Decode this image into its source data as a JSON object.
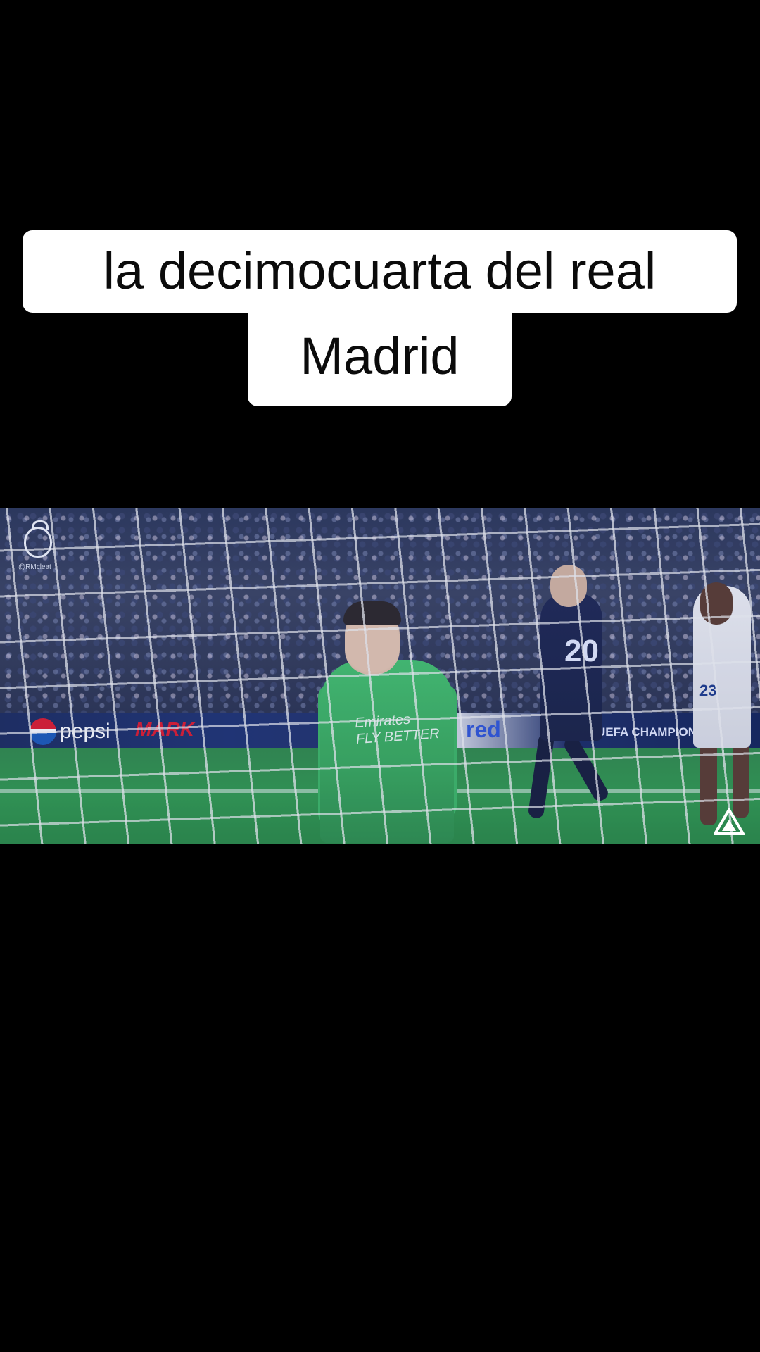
{
  "caption": {
    "line1": "la decimocuarta del real",
    "line2": "Madrid"
  },
  "video": {
    "sponsor_shirt": "Emirates\nFLY BETTER",
    "opponent_number": "20",
    "defender_number": "23",
    "boards": {
      "pepsi": "pepsi",
      "mark": "MARK",
      "red": "red",
      "ucl": "UEFA CHAMPIONS"
    },
    "watermark_handle": "@RMcleat"
  },
  "colors": {
    "background": "#000000",
    "caption_bg": "#ffffff",
    "caption_text": "#0b0b0b",
    "keeper_kit": "#3cb862"
  },
  "icons": {
    "crest": "club-crest-icon",
    "watermark": "triangle-logo-icon"
  }
}
